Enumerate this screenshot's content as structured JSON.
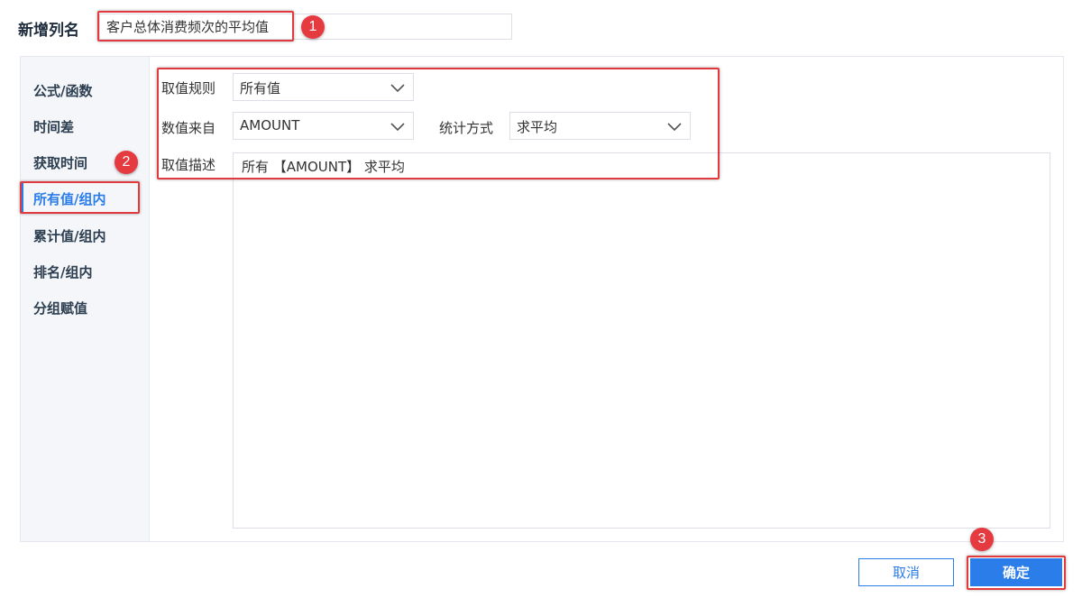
{
  "column_name": {
    "label": "新增列名",
    "value": "客户总体消费频次的平均值"
  },
  "sidebar": {
    "items": [
      {
        "label": "公式/函数",
        "active": false
      },
      {
        "label": "时间差",
        "active": false
      },
      {
        "label": "获取时间",
        "active": false
      },
      {
        "label": "所有值/组内",
        "active": true
      },
      {
        "label": "累计值/组内",
        "active": false
      },
      {
        "label": "排名/组内",
        "active": false
      },
      {
        "label": "分组赋值",
        "active": false
      }
    ]
  },
  "form": {
    "rule_label": "取值规则",
    "rule_value": "所有值",
    "source_label": "数值来自",
    "source_value": "AMOUNT",
    "stat_label": "统计方式",
    "stat_value": "求平均",
    "desc_label": "取值描述",
    "desc_value": "所有 【AMOUNT】 求平均"
  },
  "buttons": {
    "cancel": "取消",
    "ok": "确定"
  },
  "annotations": {
    "badge1": "1",
    "badge2": "2",
    "badge3": "3"
  },
  "colors": {
    "accent": "#2b7de9",
    "highlight": "#e0393e",
    "sidebar_bg": "#f4f6f9"
  },
  "icons": [
    "chevron-down-icon"
  ]
}
